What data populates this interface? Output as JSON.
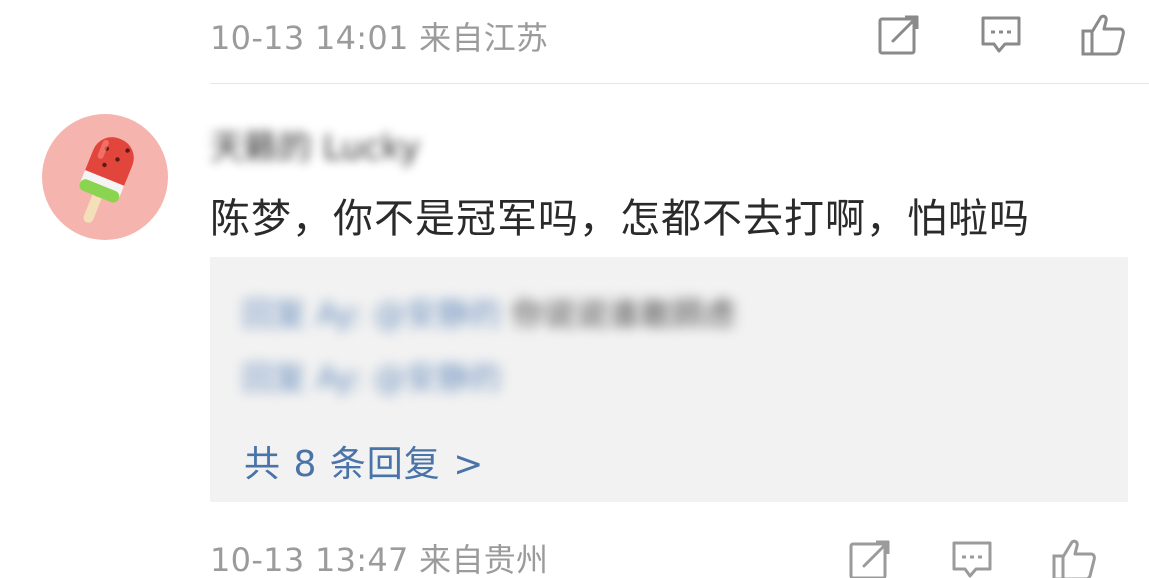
{
  "previous_comment": {
    "meta": "10-13 14:01 来自江苏"
  },
  "actions": {
    "repost_icon": "share-edit-icon",
    "reply_icon": "comment-bubble-icon",
    "like_icon": "thumbs-up-icon"
  },
  "comment": {
    "username": "天籁的 Lucky",
    "text": "陈梦，你不是冠军吗，怎都不去打啊，怕啦吗",
    "replies": [
      {
        "author": "回复 Ay: @安静的",
        "body": "你说说谁敢顾虑"
      },
      {
        "author": "回复 Ay: @安静的",
        "body": ""
      }
    ],
    "more_replies": "共 8 条回复 >",
    "meta": "10-13 13:47 来自贵州"
  },
  "colors": {
    "meta_gray": "#9b9b9b",
    "link_blue": "#4a73a8",
    "reply_bg": "#f2f2f2",
    "avatar_bg": "#f6b4ae"
  }
}
